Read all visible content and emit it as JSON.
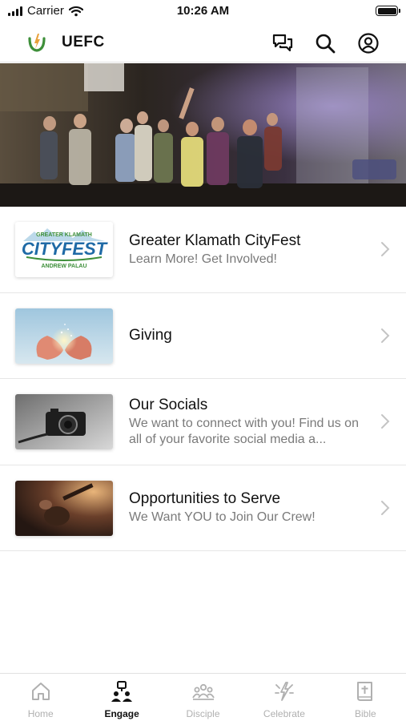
{
  "status_bar": {
    "carrier": "Carrier",
    "time": "10:26 AM"
  },
  "header": {
    "title": "UEFC",
    "icons": [
      "chat-icon",
      "search-icon",
      "profile-icon"
    ]
  },
  "hero": {
    "description_icon": "worship-band-photo"
  },
  "list": {
    "items": [
      {
        "title": "Greater Klamath CityFest",
        "subtitle": "Learn More! Get Involved!",
        "thumb": {
          "top_text": "GREATER KLAMATH",
          "main_text": "CITYFEST",
          "bottom_text": "ANDREW PALAU"
        }
      },
      {
        "title": "Giving",
        "subtitle": ""
      },
      {
        "title": "Our Socials",
        "subtitle": "We want to connect with you! Find us on all of your favorite social media a..."
      },
      {
        "title": "Opportunities to Serve",
        "subtitle": "We Want YOU to Join Our Crew!"
      }
    ]
  },
  "tabs": [
    {
      "label": "Home",
      "icon": "home-icon",
      "active": false
    },
    {
      "label": "Engage",
      "icon": "engage-icon",
      "active": true
    },
    {
      "label": "Disciple",
      "icon": "group-icon",
      "active": false
    },
    {
      "label": "Celebrate",
      "icon": "celebrate-icon",
      "active": false
    },
    {
      "label": "Bible",
      "icon": "bible-icon",
      "active": false
    }
  ],
  "colors": {
    "accent_green": "#3e8f3a",
    "accent_orange": "#e9a13b",
    "cityfest_blue": "#1f6aa6",
    "subtitle_gray": "#7a7a7a",
    "tab_inactive": "#b0b0b0"
  }
}
